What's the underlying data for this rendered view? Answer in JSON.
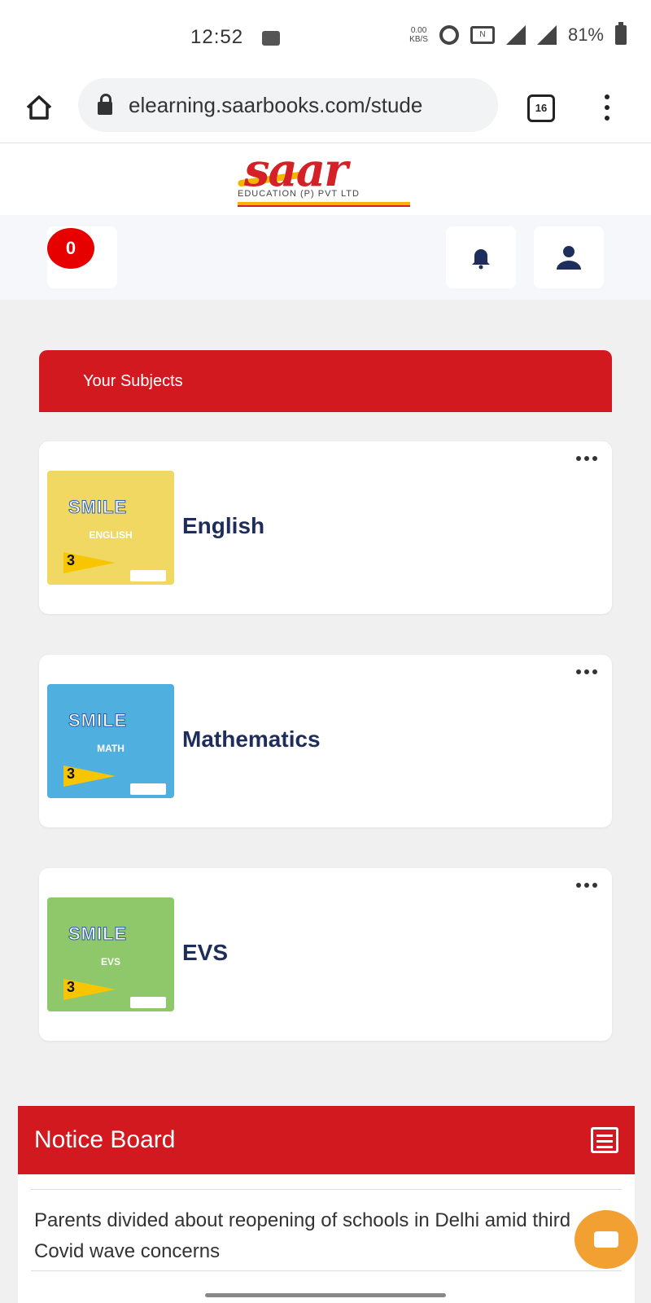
{
  "status_bar": {
    "time": "12:52",
    "net_speed_top": "0.00",
    "net_speed_unit": "KB/S",
    "battery": "81%",
    "icons": [
      "gallery-icon",
      "alarm-icon",
      "nfc-icon",
      "signal-icon",
      "wifi-signal-icon",
      "battery-icon"
    ]
  },
  "browser": {
    "url": "elearning.saarbooks.com/stude",
    "tab_count": "16"
  },
  "logo": {
    "brand": "saar",
    "tagline": "EDUCATION (P) PVT LTD",
    "colors": {
      "primary": "#d42027",
      "accent": "#f5b400"
    }
  },
  "topnav": {
    "cart_count": "0"
  },
  "subjects": {
    "header": "Your Subjects",
    "items": [
      {
        "name": "English",
        "cover_title": "SMILE",
        "cover_subject": "ENGLISH",
        "cover_level": "3",
        "cover_color": "#f0d862"
      },
      {
        "name": "Mathematics",
        "cover_title": "SMILE",
        "cover_subject": "MATH",
        "cover_level": "3",
        "cover_color": "#4fb0e0"
      },
      {
        "name": "EVS",
        "cover_title": "SMILE",
        "cover_subject": "EVS",
        "cover_level": "3",
        "cover_color": "#8ec86a"
      }
    ]
  },
  "notice_board": {
    "title": "Notice Board",
    "items": [
      "Parents divided about reopening of schools in Delhi amid third Covid wave concerns"
    ]
  },
  "theme": {
    "red": "#d1191f",
    "navy": "#1f2d5a",
    "fab": "#f2a032"
  }
}
